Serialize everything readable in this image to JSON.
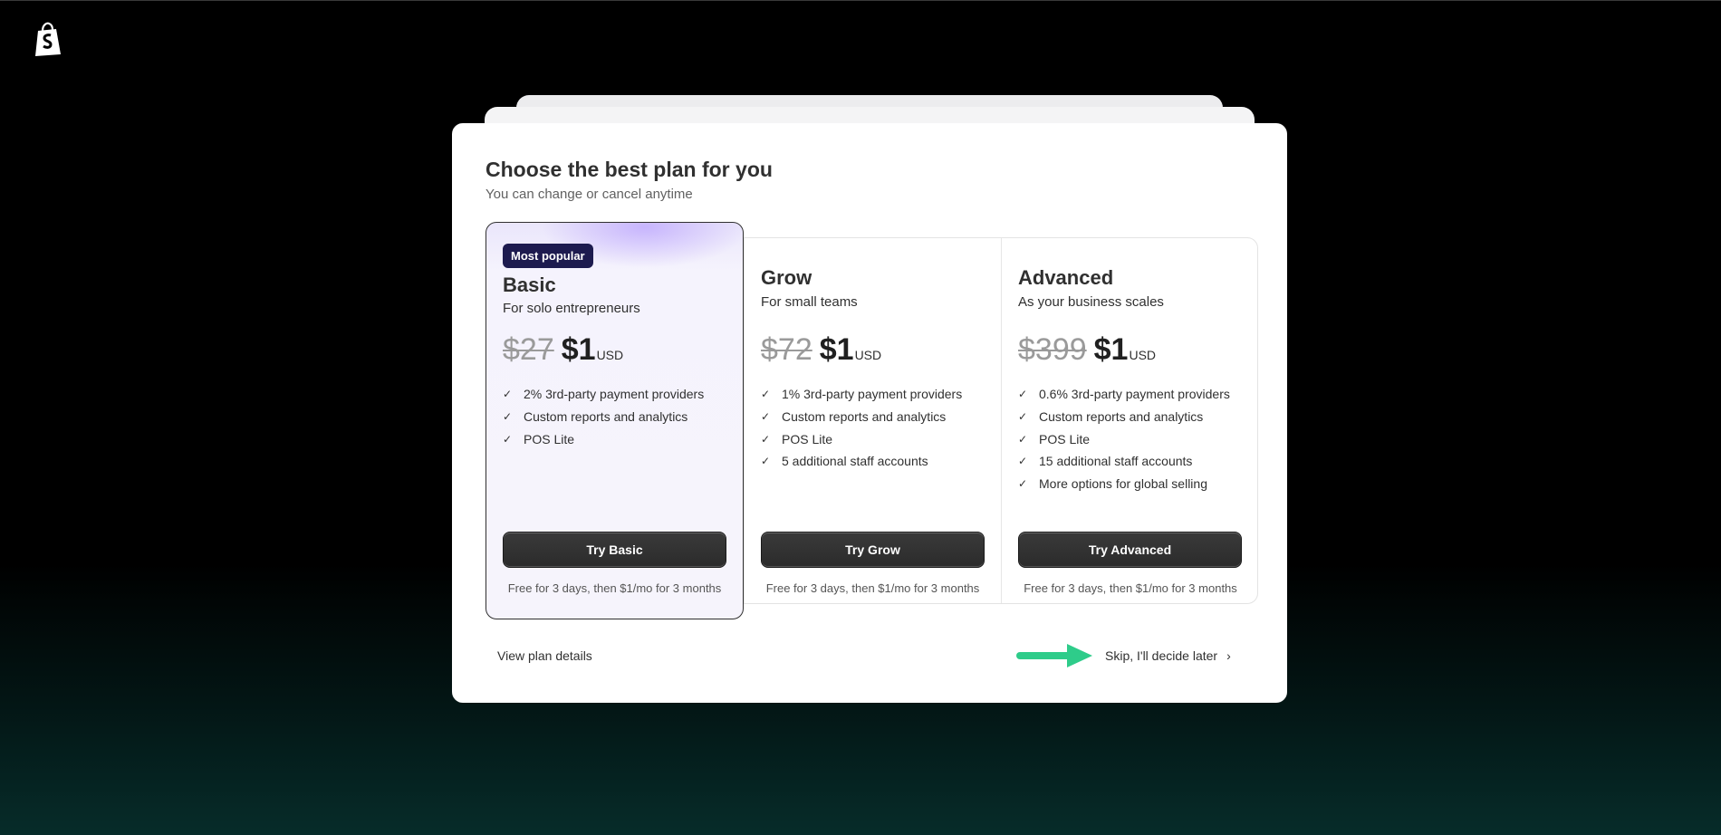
{
  "brand": {
    "logo_icon": "shopify-bag-icon"
  },
  "modal": {
    "title": "Choose the best plan for you",
    "subtitle": "You can change or cancel anytime"
  },
  "plans": [
    {
      "badge": "Most popular",
      "name": "Basic",
      "description": "For solo entrepreneurs",
      "old_price": "$27",
      "price": "$1",
      "currency": "USD",
      "features": [
        "2% 3rd-party payment providers",
        "Custom reports and analytics",
        "POS Lite"
      ],
      "button": "Try Basic",
      "note": "Free for 3 days, then $1/mo for 3 months"
    },
    {
      "name": "Grow",
      "description": "For small teams",
      "old_price": "$72",
      "price": "$1",
      "currency": "USD",
      "features": [
        "1% 3rd-party payment providers",
        "Custom reports and analytics",
        "POS Lite",
        "5 additional staff accounts"
      ],
      "button": "Try Grow",
      "note": "Free for 3 days, then $1/mo for 3 months"
    },
    {
      "name": "Advanced",
      "description": "As your business scales",
      "old_price": "$399",
      "price": "$1",
      "currency": "USD",
      "features": [
        "0.6% 3rd-party payment providers",
        "Custom reports and analytics",
        "POS Lite",
        "15 additional staff accounts",
        "More options for global selling"
      ],
      "button": "Try Advanced",
      "note": "Free for 3 days, then $1/mo for 3 months"
    }
  ],
  "footer": {
    "view_details": "View plan details",
    "skip": "Skip, I'll decide later",
    "skip_icon": "chevron-right-icon",
    "pointer_icon": "green-arrow-icon"
  },
  "colors": {
    "background": "#000000",
    "badge": "#1d1b4f",
    "button": "#303030",
    "arrow": "#2ecc8a"
  }
}
